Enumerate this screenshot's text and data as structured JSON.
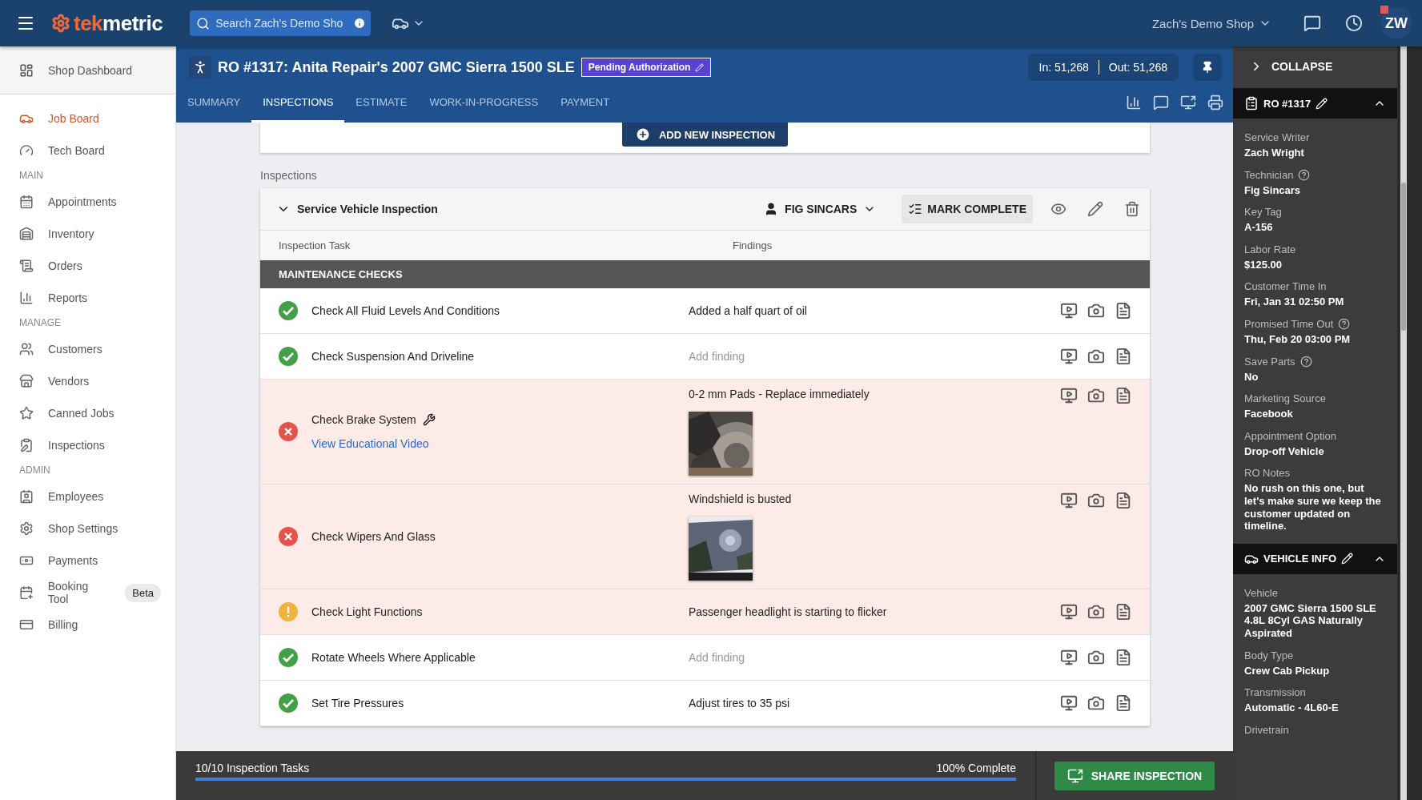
{
  "topbar": {
    "logo": {
      "accent": "tek",
      "rest": "metric"
    },
    "search": {
      "placeholder": "Search Zach's Demo Sho"
    },
    "shop": "Zach's Demo Shop",
    "avatar": "ZW",
    "notification": true
  },
  "sidebar": {
    "dashboard": "Shop Dashboard",
    "items": [
      {
        "kind": "link",
        "label": "Job Board",
        "selected": true
      },
      {
        "kind": "link",
        "label": "Tech Board",
        "selected": false
      },
      {
        "kind": "heading",
        "label": "MAIN"
      },
      {
        "kind": "link",
        "label": "Appointments",
        "selected": false
      },
      {
        "kind": "link",
        "label": "Inventory",
        "selected": false
      },
      {
        "kind": "link",
        "label": "Orders",
        "selected": false
      },
      {
        "kind": "link",
        "label": "Reports",
        "selected": false
      },
      {
        "kind": "heading",
        "label": "MANAGE"
      },
      {
        "kind": "link",
        "label": "Customers",
        "selected": false
      },
      {
        "kind": "link",
        "label": "Vendors",
        "selected": false
      },
      {
        "kind": "link",
        "label": "Canned Jobs",
        "selected": false
      },
      {
        "kind": "link",
        "label": "Inspections",
        "selected": false
      },
      {
        "kind": "heading",
        "label": "ADMIN"
      },
      {
        "kind": "link",
        "label": "Employees",
        "selected": false
      },
      {
        "kind": "link",
        "label": "Shop Settings",
        "selected": false
      },
      {
        "kind": "link",
        "label": "Payments",
        "selected": false
      },
      {
        "kind": "link",
        "label": "Booking Tool",
        "selected": false,
        "badge": "Beta"
      },
      {
        "kind": "link",
        "label": "Billing",
        "selected": false
      }
    ]
  },
  "ro": {
    "title": "RO #1317: Anita Repair's 2007 GMC Sierra 1500 SLE",
    "status": "Pending Authorization",
    "mileage_in": "In: 51,268",
    "mileage_out": "Out: 51,268",
    "tabs": [
      {
        "label": "SUMMARY",
        "selected": false
      },
      {
        "label": "INSPECTIONS",
        "selected": true
      },
      {
        "label": "ESTIMATE",
        "selected": false
      },
      {
        "label": "WORK-IN-PROGRESS",
        "selected": false
      },
      {
        "label": "PAYMENT",
        "selected": false
      }
    ]
  },
  "add_button": "ADD NEW INSPECTION",
  "section_label": "Inspections",
  "inspection": {
    "title": "Service Vehicle Inspection",
    "expanded": true,
    "technician": "FIG SINCARS",
    "mark_complete": "MARK COMPLETE",
    "columns": [
      "Inspection Task",
      "Findings"
    ],
    "group": "MAINTENANCE CHECKS",
    "tasks": [
      {
        "kind": "pass",
        "name": "Check All Fluid Levels And Conditions",
        "finding": "Added a half quart of oil"
      },
      {
        "kind": "pass",
        "name": "Check Suspension And Driveline",
        "placeholder": "Add finding"
      },
      {
        "kind": "fail",
        "name": "Check Brake System",
        "tip": true,
        "link": "View Educational Video",
        "finding": "0-2 mm Pads - Replace immediately",
        "photo": true
      },
      {
        "kind": "fail",
        "name": "Check Wipers And Glass",
        "finding": "Windshield is busted",
        "photo": true
      },
      {
        "kind": "warn",
        "name": "Check Light Functions",
        "finding": "Passenger headlight is starting to flicker"
      },
      {
        "kind": "pass",
        "name": "Rotate Wheels Where Applicable",
        "placeholder": "Add finding"
      },
      {
        "kind": "pass",
        "name": "Set Tire Pressures",
        "finding": "Adjust tires to 35 psi"
      }
    ]
  },
  "progress": {
    "tasks": "10/10 Inspection Tasks",
    "percent": "100% Complete",
    "level": 1.0,
    "share": "SHARE INSPECTION"
  },
  "panel": {
    "collapse": "COLLAPSE",
    "sections": [
      {
        "title": "RO #1317",
        "expanded": true,
        "fields": [
          {
            "label": "Service Writer",
            "value": "Zach Wright"
          },
          {
            "label": "Technician",
            "help": true,
            "value": "Fig Sincars"
          },
          {
            "label": "Key Tag",
            "value": "A-156"
          },
          {
            "label": "Labor Rate",
            "value": "$125.00"
          },
          {
            "label": "Customer Time In",
            "value": "Fri, Jan 31 02:50 PM"
          },
          {
            "label": "Promised Time Out",
            "help": true,
            "value": "Thu, Feb 20 03:00 PM"
          },
          {
            "label": "Save Parts",
            "help": true,
            "value": "No"
          },
          {
            "label": "Marketing Source",
            "value": "Facebook"
          },
          {
            "label": "Appointment Option",
            "value": "Drop-off Vehicle"
          },
          {
            "label": "RO Notes",
            "value": "No rush on this one, but let's make sure we keep the customer updated on timeline."
          }
        ]
      },
      {
        "title": "VEHICLE INFO",
        "expanded": true,
        "fields": [
          {
            "label": "Vehicle",
            "value": "2007 GMC Sierra 1500 SLE 4.8L 8Cyl GAS Naturally Aspirated"
          },
          {
            "label": "Body Type",
            "value": "Crew Cab Pickup"
          },
          {
            "label": "Transmission",
            "value": "Automatic - 4L60-E"
          },
          {
            "label": "Drivetrain"
          }
        ]
      }
    ]
  }
}
